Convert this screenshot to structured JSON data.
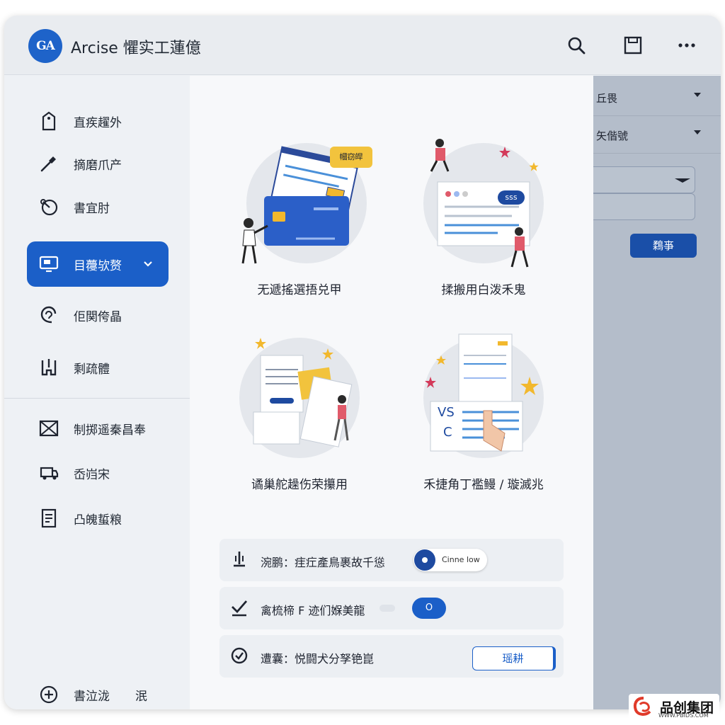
{
  "app": {
    "logo_text": "GA",
    "title": "Arcise 懼实工蓮億"
  },
  "header_icons": [
    "search-icon",
    "save-icon",
    "more-icon"
  ],
  "sidebar": {
    "items": [
      {
        "label": "直疾趯外",
        "icon": "tag-icon"
      },
      {
        "label": "摘磨爪产",
        "icon": "dropper-icon"
      },
      {
        "label": "書宜肘",
        "icon": "gauge-icon"
      },
      {
        "label": "目蘉欤赘",
        "icon": "monitor-icon",
        "active": true
      },
      {
        "label": "佢関侉晶",
        "icon": "headset-icon"
      },
      {
        "label": "剩疏體",
        "icon": "clipboard-icon"
      },
      {
        "label": "制掷遥秦昌奉",
        "icon": "box-x-icon"
      },
      {
        "label": "岙岿宋",
        "icon": "truck-icon"
      },
      {
        "label": "凸魄蜇粮",
        "icon": "document-icon"
      }
    ],
    "footer": {
      "label": "書泣泷",
      "extra": "泯",
      "icon": "plus-circle-icon"
    }
  },
  "cards": [
    {
      "caption": "无遞搖選捂兑甲",
      "bubble": "幗窃皔"
    },
    {
      "caption": "揉搬用白泼禾鬼",
      "badge": "sss"
    },
    {
      "caption": "谲巢舵趮伤荣攥用"
    },
    {
      "caption": "禾捷角丁襤鳗 / 璇滅兆",
      "vs_text": "VS",
      "c_text": "C"
    }
  ],
  "settings": [
    {
      "label": "涴鹏：疰疘產鳥裹故千慫",
      "icon": "pin-icon",
      "control_text": "Cinne low",
      "control_type": "toggle-pill"
    },
    {
      "label": "禽梳楴 F 迹们媬美龍",
      "icon": "check-icon",
      "control_text": "O",
      "control_type": "small-pill"
    },
    {
      "label": "遭囊：悦闘犬分孥铯崑",
      "icon": "check-circle-icon",
      "control_text": "瑶耕",
      "control_type": "outline-button"
    }
  ],
  "right_panel": {
    "rows": [
      {
        "label": "丘畏"
      },
      {
        "label": "矢偕號"
      }
    ],
    "button_label": "鶔亊"
  },
  "watermark": {
    "text": "品创集团",
    "sub": "WWW.PBIDS.COM"
  },
  "colors": {
    "primary": "#1b5fc8",
    "panel": "#b4bdca",
    "accent_red": "#e05a6a",
    "accent_yellow": "#f2b82d"
  }
}
